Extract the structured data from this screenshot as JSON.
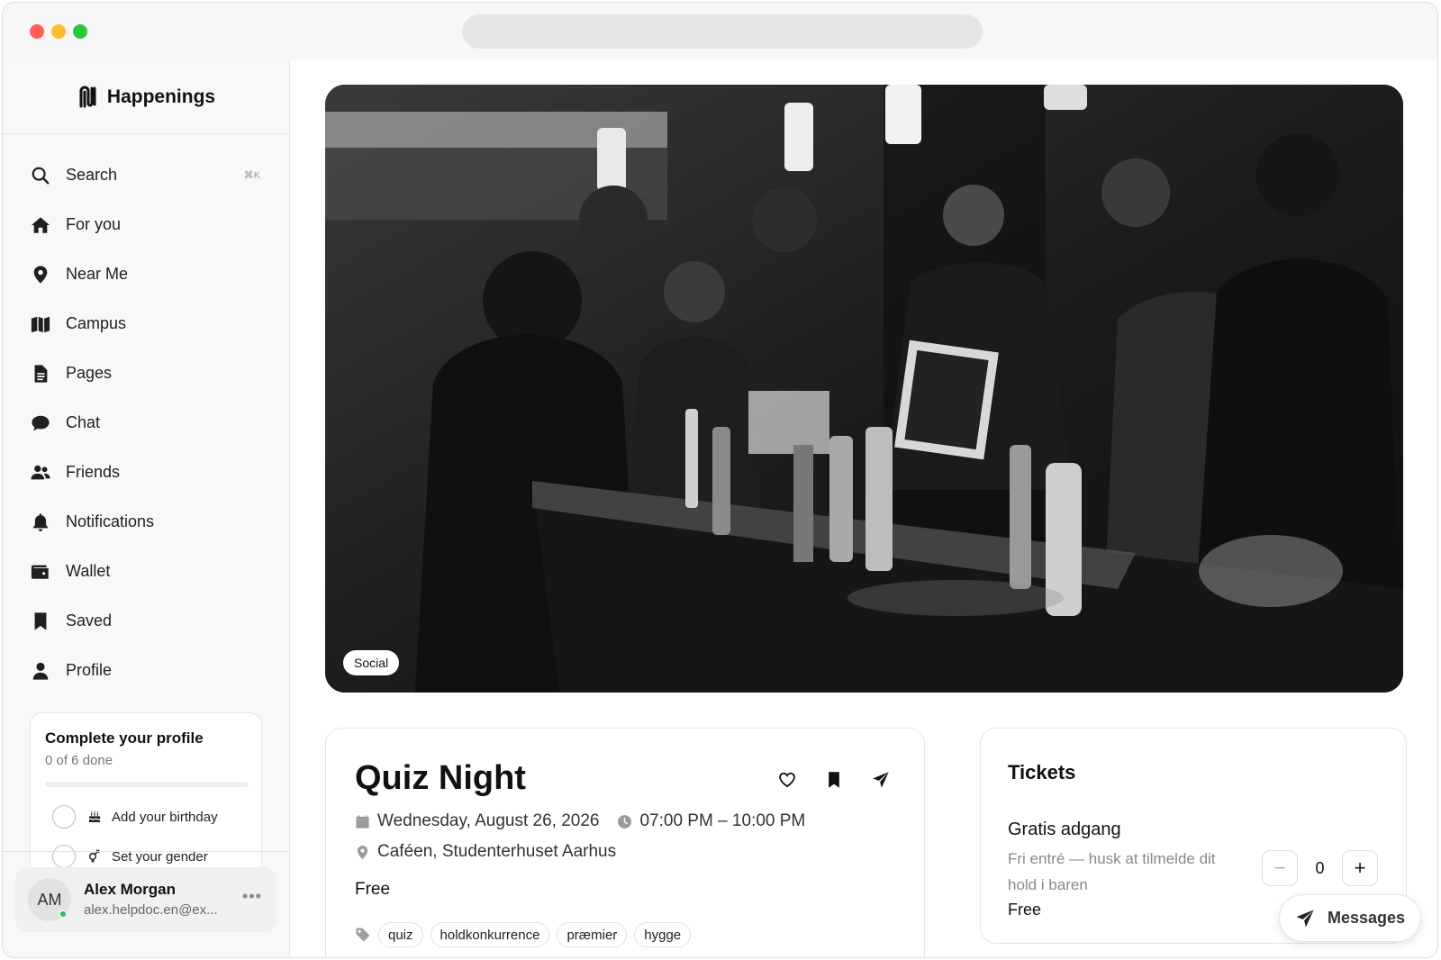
{
  "app": {
    "name": "Happenings"
  },
  "sidebar": {
    "items": [
      {
        "label": "Search",
        "icon": "search-icon",
        "shortcut": "⌘K"
      },
      {
        "label": "For you",
        "icon": "home-icon"
      },
      {
        "label": "Near Me",
        "icon": "map-pin-icon"
      },
      {
        "label": "Campus",
        "icon": "map-icon"
      },
      {
        "label": "Pages",
        "icon": "file-icon"
      },
      {
        "label": "Chat",
        "icon": "chat-bubble-icon"
      },
      {
        "label": "Friends",
        "icon": "users-icon"
      },
      {
        "label": "Notifications",
        "icon": "bell-icon"
      },
      {
        "label": "Wallet",
        "icon": "wallet-icon"
      },
      {
        "label": "Saved",
        "icon": "bookmark-icon"
      },
      {
        "label": "Profile",
        "icon": "user-icon"
      }
    ],
    "profile_card": {
      "title": "Complete your profile",
      "progress_text": "0 of 6 done",
      "progress": 0,
      "tasks": [
        {
          "label": "Add your birthday",
          "icon": "cake-icon"
        },
        {
          "label": "Set your gender",
          "icon": "gender-icon"
        }
      ]
    },
    "user": {
      "initials": "AM",
      "name": "Alex Morgan",
      "email": "alex.helpdoc.en@ex...",
      "more": "•••"
    }
  },
  "event": {
    "category": "Social",
    "title": "Quiz Night",
    "date": "Wednesday, August 26, 2026",
    "time": "07:00 PM – 10:00 PM",
    "location": "Caféen, Studenterhuset Aarhus",
    "price": "Free",
    "tags": [
      "quiz",
      "holdkonkurrence",
      "præmier",
      "hygge"
    ],
    "actions": [
      "heart-icon",
      "bookmark-icon",
      "send-icon"
    ]
  },
  "tickets": {
    "title": "Tickets",
    "items": [
      {
        "name": "Gratis adgang",
        "description": "Fri entré — husk at tilmelde dit hold i baren",
        "price": "Free",
        "quantity": "0"
      }
    ]
  },
  "messages_button": {
    "label": "Messages"
  },
  "colors": {
    "traffic_red": "#ff5f57",
    "traffic_yellow": "#febc2e",
    "traffic_green": "#28c840",
    "online": "#22c55e"
  }
}
